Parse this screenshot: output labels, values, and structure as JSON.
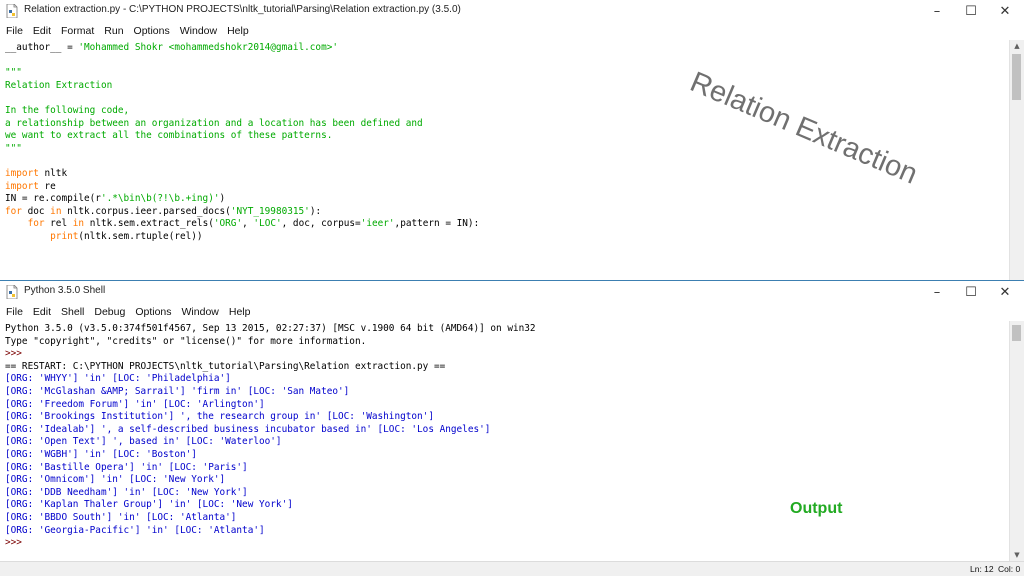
{
  "editor": {
    "title": "Relation extraction.py - C:\\PYTHON PROJECTS\\nltk_tutorial\\Parsing\\Relation extraction.py (3.5.0)",
    "menu": [
      "File",
      "Edit",
      "Format",
      "Run",
      "Options",
      "Window",
      "Help"
    ],
    "code": [
      [
        [
          "",
          "__author__ = "
        ],
        [
          "str",
          "'Mohammed Shokr <mohammedshokr2014@gmail.com>'"
        ]
      ],
      [],
      [
        [
          "str",
          "\"\"\""
        ]
      ],
      [
        [
          "str",
          "Relation Extraction"
        ]
      ],
      [],
      [
        [
          "str",
          "In the following code,"
        ]
      ],
      [
        [
          "str",
          "a relationship between an organization and a location has been defined and"
        ]
      ],
      [
        [
          "str",
          "we want to extract all the combinations of these patterns."
        ]
      ],
      [
        [
          "str",
          "\"\"\""
        ]
      ],
      [],
      [
        [
          "kw",
          "import"
        ],
        [
          "",
          " nltk"
        ]
      ],
      [
        [
          "kw",
          "import"
        ],
        [
          "",
          " re"
        ]
      ],
      [
        [
          "",
          "IN = re.compile(r"
        ],
        [
          "str",
          "'.*\\bin\\b(?!\\b.+ing)'"
        ],
        [
          "",
          ")"
        ]
      ],
      [
        [
          "kw",
          "for"
        ],
        [
          "",
          " doc "
        ],
        [
          "kw",
          "in"
        ],
        [
          "",
          " nltk.corpus.ieer.parsed_docs("
        ],
        [
          "str",
          "'NYT_19980315'"
        ],
        [
          "",
          "):"
        ]
      ],
      [
        [
          "",
          "    "
        ],
        [
          "kw",
          "for"
        ],
        [
          "",
          " rel "
        ],
        [
          "kw",
          "in"
        ],
        [
          "",
          " nltk.sem.extract_rels("
        ],
        [
          "str",
          "'ORG'"
        ],
        [
          "",
          ", "
        ],
        [
          "str",
          "'LOC'"
        ],
        [
          "",
          ", doc, corpus="
        ],
        [
          "str",
          "'ieer'"
        ],
        [
          "",
          ",pattern = IN):"
        ]
      ],
      [
        [
          "",
          "        "
        ],
        [
          "kw",
          "print"
        ],
        [
          "",
          "(nltk.sem.rtuple(rel))"
        ]
      ]
    ]
  },
  "shell": {
    "title": "Python 3.5.0 Shell",
    "menu": [
      "File",
      "Edit",
      "Shell",
      "Debug",
      "Options",
      "Window",
      "Help"
    ],
    "lines": [
      [
        [
          "",
          "Python 3.5.0 (v3.5.0:374f501f4567, Sep 13 2015, 02:27:37) [MSC v.1900 64 bit (AMD64)] on win32"
        ]
      ],
      [
        [
          "",
          "Type \"copyright\", \"credits\" or \"license()\" for more information."
        ]
      ],
      [
        [
          "prompt",
          ">>>"
        ]
      ],
      [
        [
          "",
          "== RESTART: C:\\PYTHON PROJECTS\\nltk_tutorial\\Parsing\\Relation extraction.py =="
        ]
      ],
      [
        [
          "out",
          "[ORG: 'WHYY'] 'in' [LOC: 'Philadelphia']"
        ]
      ],
      [
        [
          "out",
          "[ORG: 'McGlashan &AMP; Sarrail'] 'firm in' [LOC: 'San Mateo']"
        ]
      ],
      [
        [
          "out",
          "[ORG: 'Freedom Forum'] 'in' [LOC: 'Arlington']"
        ]
      ],
      [
        [
          "out",
          "[ORG: 'Brookings Institution'] ', the research group in' [LOC: 'Washington']"
        ]
      ],
      [
        [
          "out",
          "[ORG: 'Idealab'] ', a self-described business incubator based in' [LOC: 'Los Angeles']"
        ]
      ],
      [
        [
          "out",
          "[ORG: 'Open Text'] ', based in' [LOC: 'Waterloo']"
        ]
      ],
      [
        [
          "out",
          "[ORG: 'WGBH'] 'in' [LOC: 'Boston']"
        ]
      ],
      [
        [
          "out",
          "[ORG: 'Bastille Opera'] 'in' [LOC: 'Paris']"
        ]
      ],
      [
        [
          "out",
          "[ORG: 'Omnicom'] 'in' [LOC: 'New York']"
        ]
      ],
      [
        [
          "out",
          "[ORG: 'DDB Needham'] 'in' [LOC: 'New York']"
        ]
      ],
      [
        [
          "out",
          "[ORG: 'Kaplan Thaler Group'] 'in' [LOC: 'New York']"
        ]
      ],
      [
        [
          "out",
          "[ORG: 'BBDO South'] 'in' [LOC: 'Atlanta']"
        ]
      ],
      [
        [
          "out",
          "[ORG: 'Georgia-Pacific'] 'in' [LOC: 'Atlanta']"
        ]
      ],
      [
        [
          "prompt",
          ">>>"
        ]
      ]
    ],
    "status": {
      "ln": "Ln: 12",
      "col": "Col: 0"
    }
  },
  "overlays": {
    "title_text": "Relation Extraction",
    "output_label": "Output"
  },
  "colors": {
    "keyword": "#ff7700",
    "string": "#00aa00",
    "output": "#0000cc",
    "prompt": "#7b0000",
    "overlay_green": "#22aa22"
  },
  "icons": [
    "python-file-icon",
    "minimize-icon",
    "maximize-icon",
    "close-icon"
  ]
}
